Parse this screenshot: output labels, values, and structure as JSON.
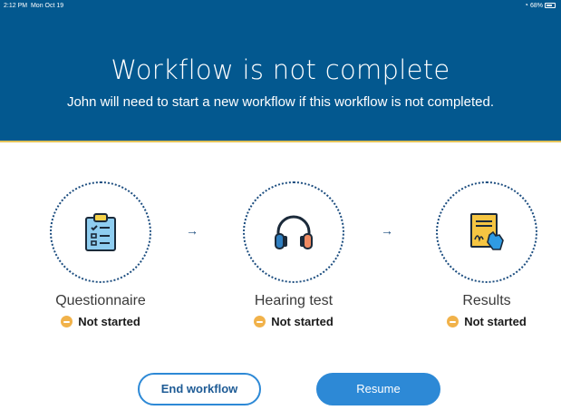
{
  "status_bar": {
    "time": "2:12 PM",
    "date": "Mon Oct 19",
    "battery": "68%"
  },
  "header": {
    "title": "Workflow is not complete",
    "subtitle": "John will need to start a new workflow if this workflow is not completed."
  },
  "steps": [
    {
      "label": "Questionnaire",
      "status": "Not started",
      "icon": "clipboard-checklist-icon"
    },
    {
      "label": "Hearing test",
      "status": "Not started",
      "icon": "headphones-icon"
    },
    {
      "label": "Results",
      "status": "Not started",
      "icon": "signed-document-icon"
    }
  ],
  "arrows": [
    "→",
    "→"
  ],
  "buttons": {
    "end": "End workflow",
    "resume": "Resume"
  },
  "colors": {
    "header_bg": "#03588f",
    "header_border": "#e4c35a",
    "accent": "#2d89d6",
    "status_dot": "#f1b24a",
    "circle": "#1c4d7f"
  }
}
